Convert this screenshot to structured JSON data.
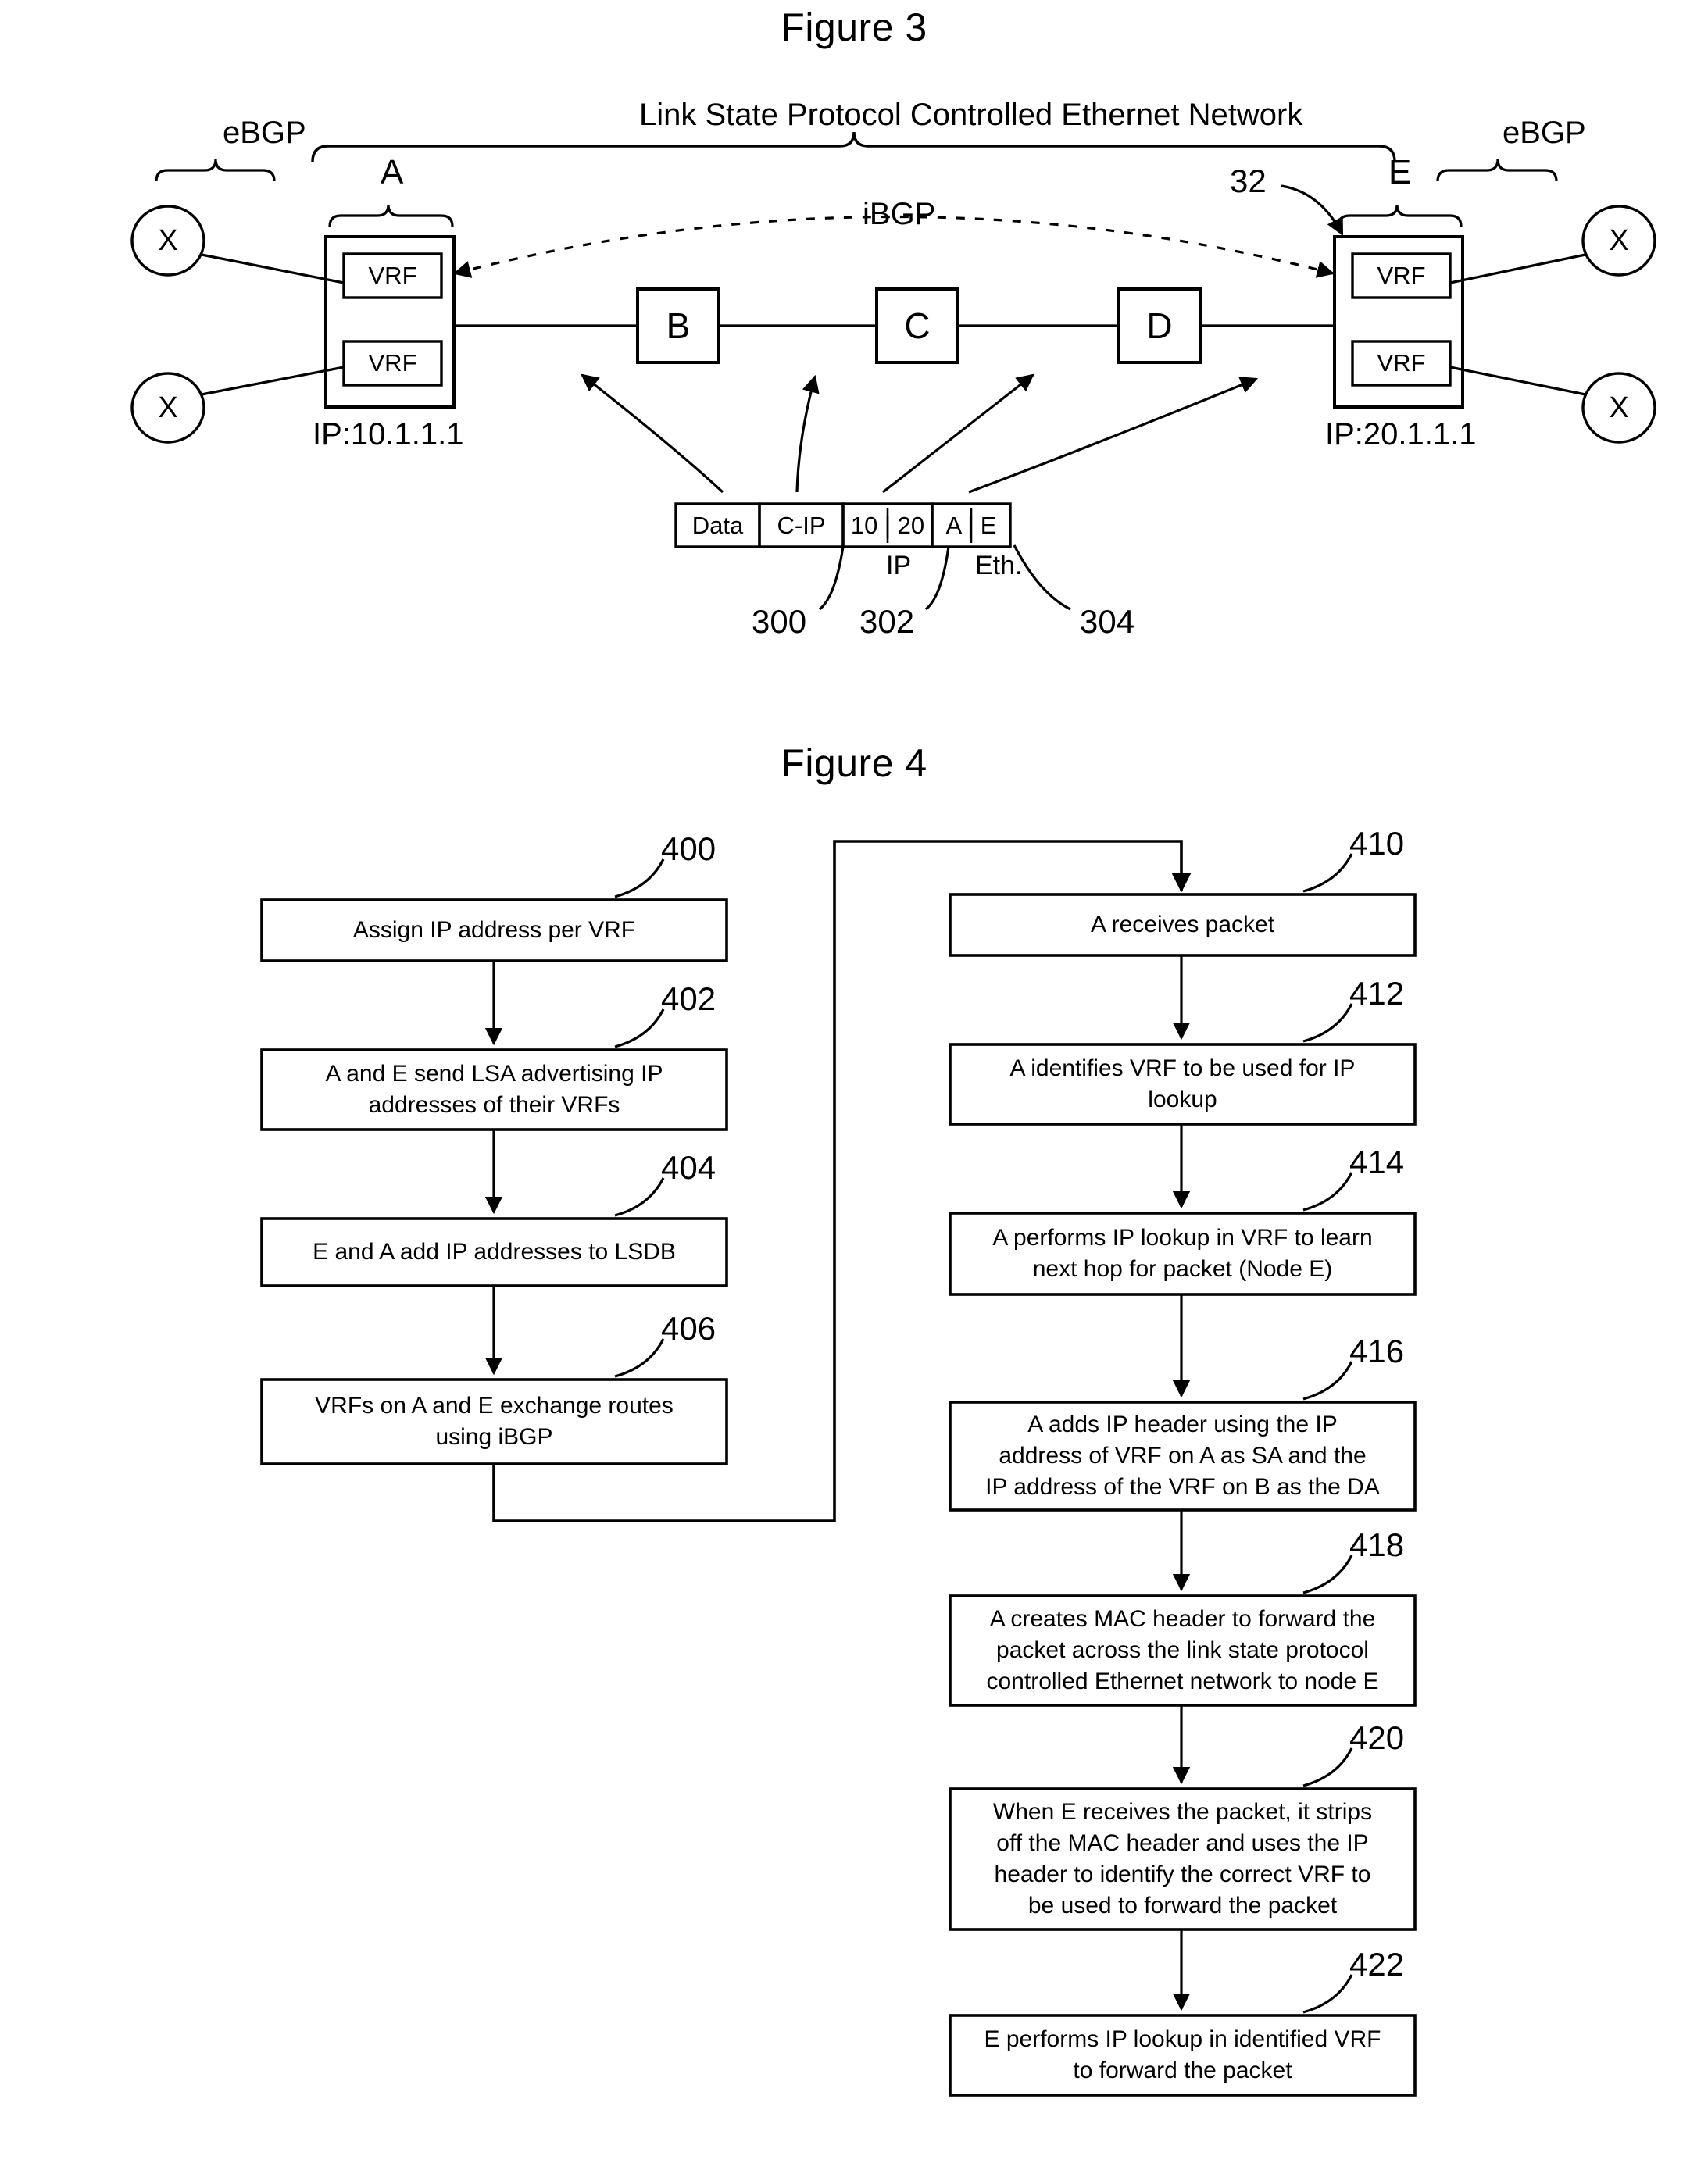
{
  "figures": {
    "figure3": {
      "title": "Figure 3",
      "network_label": "Link State Protocol Controlled Ethernet Network",
      "ibgp_label": "iBGP",
      "ebgp_left_label": "eBGP",
      "ebgp_right_label": "eBGP",
      "reference_32": "32",
      "node_a_letter": "A",
      "node_e_letter": "E",
      "node_a_ip": "IP:10.1.1.1",
      "node_e_ip": "IP:20.1.1.1",
      "vrf_label": "VRF",
      "customer_label": "X",
      "core_nodes": [
        "B",
        "C",
        "D"
      ],
      "packet": {
        "cells": [
          "Data",
          "C-IP",
          "10 | 20",
          "A | E"
        ],
        "sub_labels": {
          "ip": "IP",
          "eth": "Eth."
        },
        "refs": [
          "300",
          "302",
          "304"
        ]
      }
    },
    "figure4": {
      "title": "Figure 4",
      "left_column": [
        {
          "ref": "400",
          "text": "Assign IP address per VRF"
        },
        {
          "ref": "402",
          "text": "A and E send LSA advertising IP\naddresses of their VRFs"
        },
        {
          "ref": "404",
          "text": "E and A add IP addresses to LSDB"
        },
        {
          "ref": "406",
          "text": "VRFs on A and E exchange routes\nusing iBGP"
        }
      ],
      "right_column": [
        {
          "ref": "410",
          "text": "A receives packet"
        },
        {
          "ref": "412",
          "text": "A identifies VRF to be used for IP\nlookup"
        },
        {
          "ref": "414",
          "text": "A performs IP lookup in VRF to learn\nnext hop for packet (Node E)"
        },
        {
          "ref": "416",
          "text": "A adds IP header using the IP\naddress of VRF on A as SA and the\nIP address of the VRF on B as the DA"
        },
        {
          "ref": "418",
          "text": "A creates MAC header to forward the\npacket across the link state protocol\ncontrolled Ethernet network to node E"
        },
        {
          "ref": "420",
          "text": "When E receives the packet, it strips\noff the MAC header and uses the IP\nheader to identify the correct VRF to\nbe used to forward the packet"
        },
        {
          "ref": "422",
          "text": "E performs IP lookup in identified VRF\nto forward the packet"
        }
      ]
    }
  },
  "colors": {
    "ink": "#000000",
    "paper": "#ffffff"
  }
}
